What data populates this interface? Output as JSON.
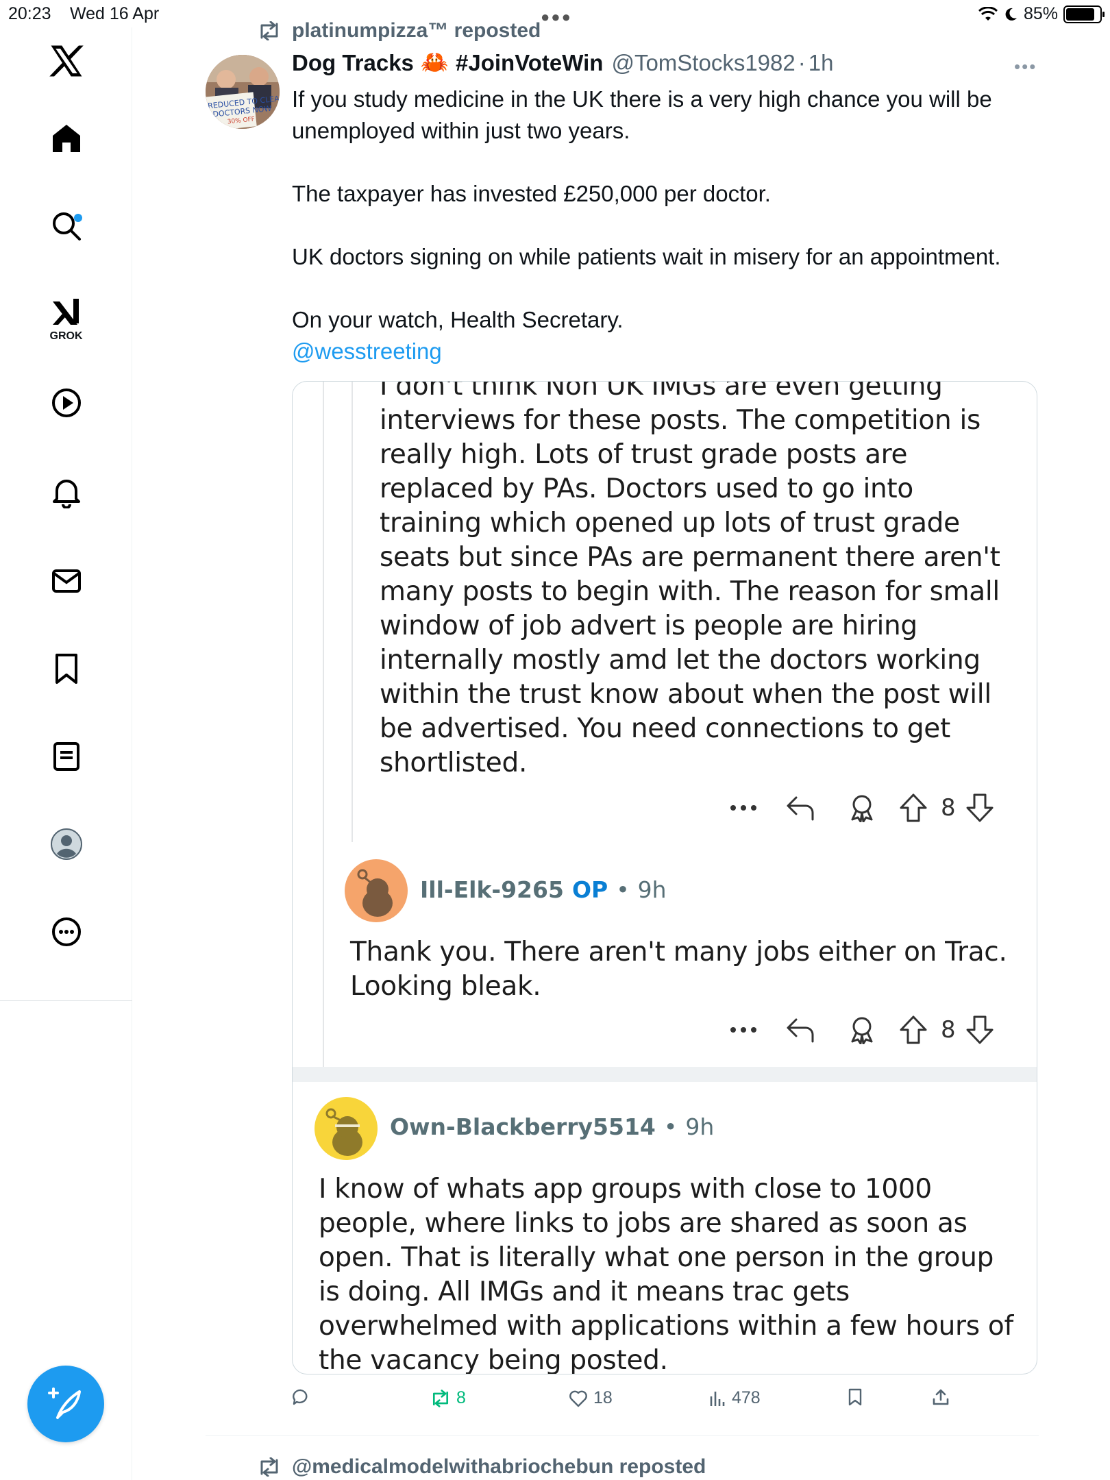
{
  "status_bar": {
    "time": "20:23",
    "date": "Wed 16 Apr",
    "battery": "85%",
    "battery_level": 0.85
  },
  "sidebar": {
    "logo": "x-logo-icon",
    "items": [
      {
        "icon": "home-icon",
        "has_badge": true
      },
      {
        "icon": "search-icon"
      },
      {
        "icon": "grok-icon",
        "label": "GROK"
      },
      {
        "icon": "video-icon"
      },
      {
        "icon": "notifications-icon"
      },
      {
        "icon": "messages-icon"
      },
      {
        "icon": "bookmarks-icon"
      },
      {
        "icon": "lists-icon"
      },
      {
        "icon": "profile-icon"
      },
      {
        "icon": "more-icon"
      }
    ],
    "compose_icon": "compose-post-icon"
  },
  "tweet": {
    "repost_by": "platinumpizza™ reposted",
    "author_name": "Dog Tracks",
    "author_emoji": "🦀",
    "author_tag": "#JoinVoteWin",
    "handle": "@TomStocks1982",
    "time": "1h",
    "text_lines": [
      "If you study medicine in the UK there is a very high chance you will be",
      "unemployed within just two years.",
      "",
      "The taxpayer has invested £250,000 per doctor.",
      "",
      "UK doctors signing on while patients wait in misery for an appointment.",
      "",
      "On your watch, Health Secretary."
    ],
    "mention": "@wesstreeting",
    "avatar_sign_text": [
      "REDUCED TO CLEAN",
      "DOCTORS NOW",
      "30% OFF"
    ],
    "embed": {
      "comment1": {
        "text_lines": [
          "I don't think Non UK IMGs are even getting",
          "interviews for these posts. The competition is",
          "really high. Lots of trust grade posts are",
          "replaced by PAs. Doctors used to go into",
          "training which opened up lots of trust grade",
          "seats but since PAs are permanent there aren't",
          "many posts to begin with. The reason for small",
          "window of job advert is people are hiring",
          "internally mostly amd let the doctors working",
          "within the trust know about when the post will",
          "be advertised. You need connections to get",
          "shortlisted."
        ],
        "votes": "8"
      },
      "comment2": {
        "username": "Ill-Elk-9265",
        "op_label": "OP",
        "time": "9h",
        "text_lines": [
          "Thank you. There aren't many jobs either on Trac.",
          "Looking bleak."
        ],
        "votes": "8"
      },
      "comment3": {
        "username": "Own-Blackberry5514",
        "time": "9h",
        "text_lines": [
          "I know of whats app groups with close to 1000",
          "people, where links to jobs are shared as soon as",
          "open. That is literally what one person in the  group",
          "is doing. All IMGs and it means trac gets",
          "overwhelmed with applications within a few hours of",
          "the vacancy being posted."
        ]
      }
    },
    "actions": {
      "replies": "",
      "reposts": "8",
      "likes": "18",
      "views": "478"
    }
  },
  "next_tweet": {
    "repost_by": "@medicalmodelwithabriochebun reposted"
  },
  "colors": {
    "accent": "#1d9bf0",
    "repost_green": "#00ba7c",
    "op_blue": "#0a7fd4",
    "muted": "#536471"
  }
}
